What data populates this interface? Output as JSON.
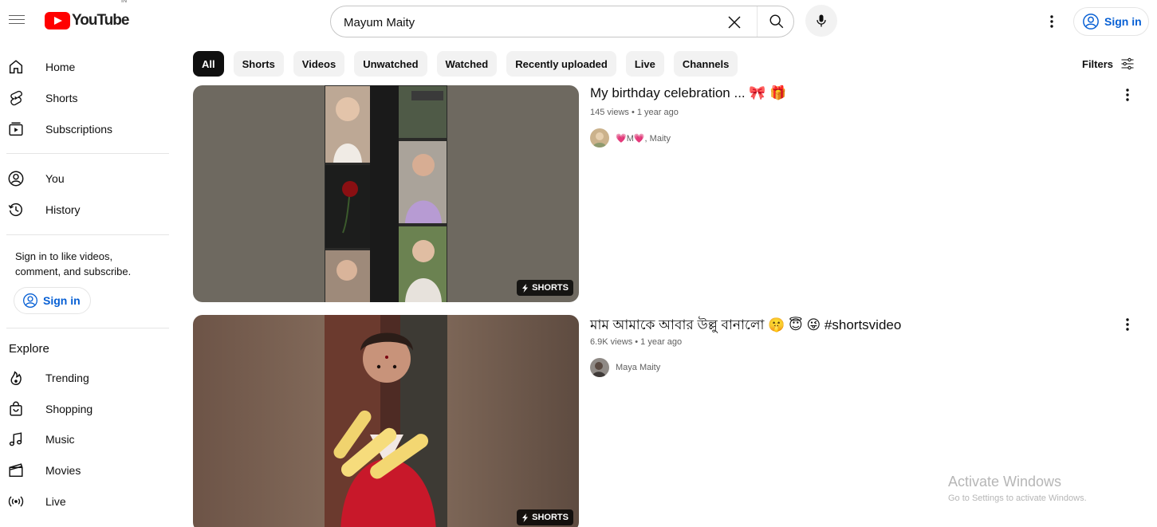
{
  "header": {
    "logo_text": "YouTube",
    "country_code": "IN",
    "search_value": "Mayum Maity",
    "signin_label": "Sign in"
  },
  "sidebar": {
    "items_top": [
      {
        "label": "Home",
        "icon": "home-icon"
      },
      {
        "label": "Shorts",
        "icon": "shorts-icon"
      },
      {
        "label": "Subscriptions",
        "icon": "subscriptions-icon"
      }
    ],
    "items_you": [
      {
        "label": "You",
        "icon": "account-icon"
      },
      {
        "label": "History",
        "icon": "history-icon"
      }
    ],
    "signin_note": "Sign in to like videos, comment, and subscribe.",
    "signin_label": "Sign in",
    "explore_title": "Explore",
    "explore_items": [
      {
        "label": "Trending",
        "icon": "trending-icon"
      },
      {
        "label": "Shopping",
        "icon": "shopping-icon"
      },
      {
        "label": "Music",
        "icon": "music-icon"
      },
      {
        "label": "Movies",
        "icon": "movies-icon"
      },
      {
        "label": "Live",
        "icon": "live-icon"
      }
    ]
  },
  "chips": [
    "All",
    "Shorts",
    "Videos",
    "Unwatched",
    "Watched",
    "Recently uploaded",
    "Live",
    "Channels"
  ],
  "active_chip": "All",
  "filters_label": "Filters",
  "results": [
    {
      "title": "My birthday celebration ... 🎀 🎁",
      "meta": "145 views • 1 year ago",
      "channel": "💗M💗, Maity",
      "badge": "SHORTS"
    },
    {
      "title": "মাম আমাকে আবার উল্লু বানালো 🤫 😇 😜 #shortsvideo",
      "meta": "6.9K views • 1 year ago",
      "channel": "Maya Maity",
      "badge": "SHORTS"
    }
  ],
  "watermark": {
    "line1": "Activate Windows",
    "line2": "Go to Settings to activate Windows."
  },
  "colors": {
    "brand_red": "#ff0000",
    "link_blue": "#065fd4",
    "chip_bg": "#f2f2f2",
    "text": "#0f0f0f",
    "secondary_text": "#606060"
  }
}
